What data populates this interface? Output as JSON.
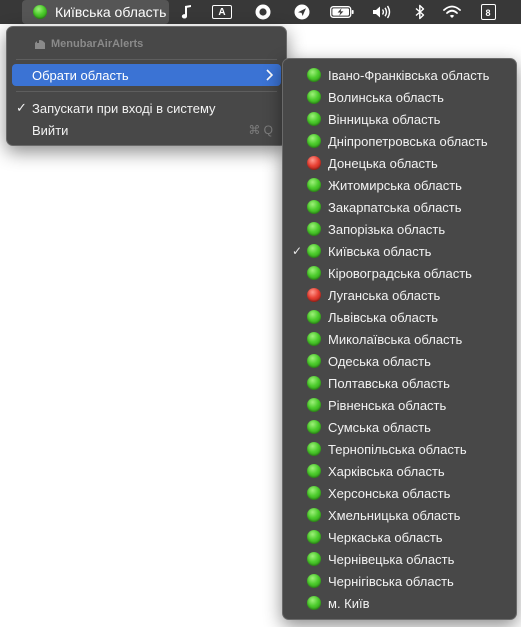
{
  "menubar": {
    "app_title": "Київська область",
    "app_status_color": "#4ccc2c",
    "input_source": "A",
    "icons": [
      "music-note-icon",
      "input-source-icon",
      "record-icon",
      "location-arrow-icon",
      "battery-charging-icon",
      "volume-icon",
      "bluetooth-icon",
      "wifi-icon",
      "calendar-icon"
    ],
    "calendar_day": "8"
  },
  "menu": {
    "header": "MenubarAirAlerts",
    "select_region_label": "Обрати область",
    "launch_at_login_label": "Запускати при вході в систему",
    "launch_at_login_checked": true,
    "quit_label": "Вийти",
    "quit_shortcut": "⌘ Q"
  },
  "submenu": {
    "check_mark": "✓",
    "selected_region": "Київська область",
    "regions": [
      {
        "name": "Івано-Франківська область",
        "status": "green"
      },
      {
        "name": "Волинська область",
        "status": "green"
      },
      {
        "name": "Вінницька область",
        "status": "green"
      },
      {
        "name": "Дніпропетровська область",
        "status": "green"
      },
      {
        "name": "Донецька область",
        "status": "red"
      },
      {
        "name": "Житомирська область",
        "status": "green"
      },
      {
        "name": "Закарпатська область",
        "status": "green"
      },
      {
        "name": "Запорізька область",
        "status": "green"
      },
      {
        "name": "Київська область",
        "status": "green",
        "checked": true
      },
      {
        "name": "Кіровоградська область",
        "status": "green"
      },
      {
        "name": "Луганська область",
        "status": "red"
      },
      {
        "name": "Львівська область",
        "status": "green"
      },
      {
        "name": "Миколаївська область",
        "status": "green"
      },
      {
        "name": "Одеська область",
        "status": "green"
      },
      {
        "name": "Полтавська область",
        "status": "green"
      },
      {
        "name": "Рівненська область",
        "status": "green"
      },
      {
        "name": "Сумська область",
        "status": "green"
      },
      {
        "name": "Тернопільська область",
        "status": "green"
      },
      {
        "name": "Харківська область",
        "status": "green"
      },
      {
        "name": "Херсонська область",
        "status": "green"
      },
      {
        "name": "Хмельницька область",
        "status": "green"
      },
      {
        "name": "Черкаська область",
        "status": "green"
      },
      {
        "name": "Чернівецька область",
        "status": "green"
      },
      {
        "name": "Чернігівська область",
        "status": "green"
      },
      {
        "name": "м. Київ",
        "status": "green"
      }
    ]
  },
  "colors": {
    "status_green": "#4ccc2c",
    "status_red": "#e84134",
    "highlight": "#3b73d4"
  }
}
